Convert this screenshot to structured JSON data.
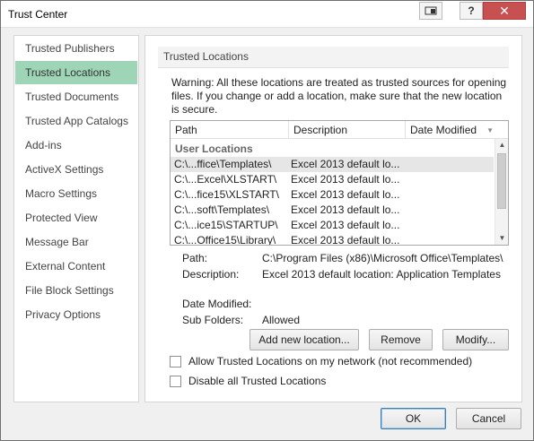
{
  "window": {
    "title": "Trust Center"
  },
  "titlebar": {
    "help_label": "?",
    "close_label": "✕"
  },
  "nav": {
    "items": [
      {
        "label": "Trusted Publishers",
        "selected": false
      },
      {
        "label": "Trusted Locations",
        "selected": true
      },
      {
        "label": "Trusted Documents",
        "selected": false
      },
      {
        "label": "Trusted App Catalogs",
        "selected": false
      },
      {
        "label": "Add-ins",
        "selected": false
      },
      {
        "label": "ActiveX Settings",
        "selected": false
      },
      {
        "label": "Macro Settings",
        "selected": false
      },
      {
        "label": "Protected View",
        "selected": false
      },
      {
        "label": "Message Bar",
        "selected": false
      },
      {
        "label": "External Content",
        "selected": false
      },
      {
        "label": "File Block Settings",
        "selected": false
      },
      {
        "label": "Privacy Options",
        "selected": false
      }
    ]
  },
  "panel": {
    "section_title": "Trusted Locations",
    "warning": "Warning: All these locations are treated as trusted sources for opening files.  If you change or add a location, make sure that the new location is secure.",
    "list": {
      "columns": [
        "Path",
        "Description",
        "Date Modified"
      ],
      "group": "User Locations",
      "rows": [
        {
          "path": "C:\\...ffice\\Templates\\",
          "description": "Excel 2013 default lo...",
          "selected": true
        },
        {
          "path": "C:\\...Excel\\XLSTART\\",
          "description": "Excel 2013 default lo...",
          "selected": false
        },
        {
          "path": "C:\\...fice15\\XLSTART\\",
          "description": "Excel 2013 default lo...",
          "selected": false
        },
        {
          "path": "C:\\...soft\\Templates\\",
          "description": "Excel 2013 default lo...",
          "selected": false
        },
        {
          "path": "C:\\...ice15\\STARTUP\\",
          "description": "Excel 2013 default lo...",
          "selected": false
        },
        {
          "path": "C:\\...Office15\\Library\\",
          "description": "Excel 2013 default lo...",
          "selected": false
        }
      ]
    },
    "details": {
      "path_label": "Path:",
      "path_value": "C:\\Program Files (x86)\\Microsoft Office\\Templates\\",
      "description_label": "Description:",
      "description_value": "Excel 2013 default location: Application Templates",
      "date_modified_label": "Date Modified:",
      "date_modified_value": "",
      "sub_folders_label": "Sub Folders:",
      "sub_folders_value": "Allowed"
    },
    "buttons": {
      "add": "Add new location...",
      "remove": "Remove",
      "modify": "Modify..."
    },
    "checkboxes": {
      "allow_network": {
        "label": "Allow Trusted Locations on my network (not recommended)",
        "checked": false
      },
      "disable_all": {
        "label": "Disable all Trusted Locations",
        "checked": false
      }
    }
  },
  "footer": {
    "ok": "OK",
    "cancel": "Cancel"
  },
  "colors": {
    "nav_selected": "#9fd5b7",
    "row_selected": "#e6e6e6",
    "close_button": "#c75050"
  }
}
